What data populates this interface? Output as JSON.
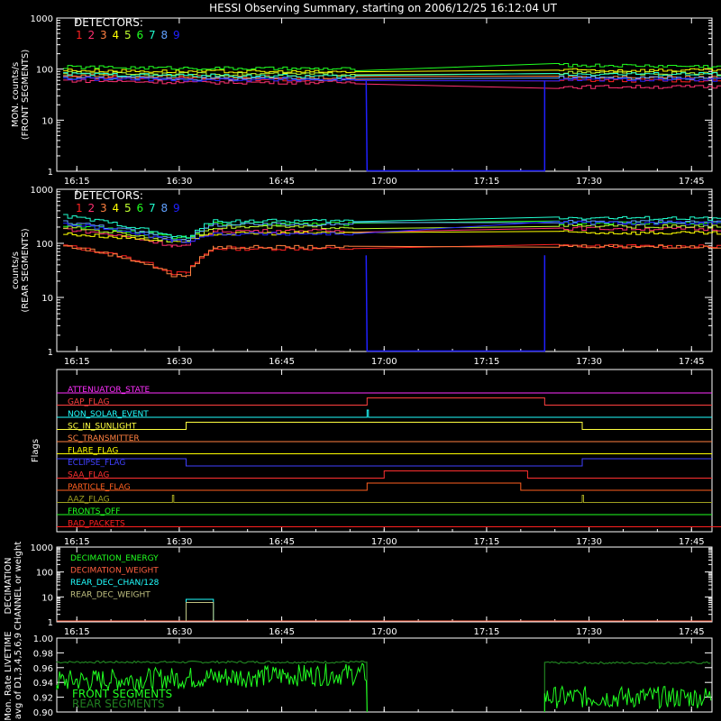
{
  "title": "HESSI Observing Summary, starting on 2006/12/25 16:12:04 UT",
  "time_ticks": [
    "16:15",
    "16:30",
    "16:45",
    "17:00",
    "17:15",
    "17:30",
    "17:45"
  ],
  "detectors": {
    "label": "DETECTORS:",
    "numbers": [
      "1",
      "2",
      "3",
      "4",
      "5",
      "6",
      "7",
      "8",
      "9"
    ],
    "colors": [
      "#ff2020",
      "#ff3070",
      "#ff8040",
      "#ffff00",
      "#c0ff30",
      "#20ff20",
      "#20ffd0",
      "#60a0ff",
      "#2020ff"
    ]
  },
  "panel1": {
    "ylabel1": "MON. counts/s",
    "ylabel2": "(FRONT SEGMENTS)",
    "yticks": [
      "1",
      "10",
      "100",
      "1000"
    ]
  },
  "panel2": {
    "ylabel1": "counts/s",
    "ylabel2": "(REAR SEGMENTS)",
    "yticks": [
      "1",
      "10",
      "100",
      "1000"
    ]
  },
  "panel3": {
    "ylabel": "Flags"
  },
  "panel4": {
    "ylabel1": "DECIMATION",
    "ylabel2": "CHANNEL or weight",
    "yticks": [
      "1",
      "10",
      "100",
      "1000"
    ]
  },
  "panel5": {
    "ylabel1": "Mon. Rate LIVETIME",
    "ylabel2": "avg of D1,3,4,5,6,9",
    "yticks": [
      "0.90",
      "0.92",
      "0.94",
      "0.96",
      "0.98",
      "1.00"
    ],
    "legend": [
      {
        "name": "FRONT SEGMENTS",
        "color": "#20ff20"
      },
      {
        "name": "REAR SEGMENTS",
        "color": "#208020"
      }
    ]
  },
  "chart_data": [
    {
      "type": "line",
      "title": "HESSI Observing Summary, starting on 2006/12/25 16:12:04 UT",
      "ylabel": "MON. counts/s (FRONT SEGMENTS)",
      "yscale": "log",
      "ylim": [
        1,
        1000
      ],
      "x_range": [
        "16:12",
        "18:00"
      ],
      "data_gap": [
        "16:57:30",
        "17:23:30"
      ],
      "series": [
        {
          "name": "1",
          "values": [
            70,
            65,
            62,
            1,
            60,
            60
          ]
        },
        {
          "name": "2",
          "values": [
            60,
            55,
            55,
            1,
            45,
            45
          ]
        },
        {
          "name": "3",
          "values": [
            75,
            70,
            68,
            1,
            70,
            70
          ]
        },
        {
          "name": "4",
          "values": [
            95,
            90,
            88,
            1,
            95,
            95
          ]
        },
        {
          "name": "5",
          "values": [
            85,
            80,
            80,
            1,
            85,
            80
          ]
        },
        {
          "name": "6",
          "values": [
            110,
            105,
            100,
            1,
            120,
            110
          ]
        },
        {
          "name": "7",
          "values": [
            80,
            75,
            72,
            1,
            80,
            80
          ]
        },
        {
          "name": "8",
          "values": [
            68,
            65,
            64,
            1,
            68,
            66
          ]
        },
        {
          "name": "9",
          "values": [
            65,
            62,
            62,
            1,
            62,
            62
          ]
        }
      ],
      "x": [
        "16:13",
        "16:30",
        "16:56",
        "17:10",
        "17:25",
        "18:00"
      ]
    },
    {
      "type": "line",
      "ylabel": "counts/s (REAR SEGMENTS)",
      "yscale": "log",
      "ylim": [
        1,
        1000
      ],
      "x": [
        "16:13",
        "16:29",
        "16:31",
        "16:35",
        "16:56",
        "17:10",
        "17:25",
        "18:00"
      ],
      "series": [
        {
          "name": "1",
          "values": [
            90,
            28,
            28,
            80,
            80,
            1,
            90,
            85
          ]
        },
        {
          "name": "2",
          "values": [
            185,
            90,
            90,
            170,
            170,
            1,
            190,
            180
          ]
        },
        {
          "name": "3",
          "values": [
            90,
            25,
            25,
            85,
            85,
            1,
            90,
            85
          ]
        },
        {
          "name": "4",
          "values": [
            150,
            110,
            110,
            150,
            160,
            1,
            160,
            150
          ]
        },
        {
          "name": "5",
          "values": [
            200,
            110,
            110,
            200,
            200,
            1,
            210,
            200
          ]
        },
        {
          "name": "6",
          "values": [
            220,
            130,
            130,
            230,
            230,
            1,
            240,
            240
          ]
        },
        {
          "name": "7",
          "values": [
            320,
            130,
            130,
            260,
            260,
            1,
            300,
            280
          ]
        },
        {
          "name": "8",
          "values": [
            250,
            120,
            120,
            220,
            230,
            1,
            250,
            250
          ]
        },
        {
          "name": "9",
          "values": [
            230,
            110,
            110,
            150,
            150,
            1,
            240,
            230
          ]
        }
      ]
    },
    {
      "type": "line",
      "ylabel": "Flags",
      "series": [
        {
          "name": "ATTENUATOR_STATE",
          "color": "#ff30ff",
          "state": "off"
        },
        {
          "name": "GAP_FLAG",
          "color": "#ff4040",
          "high": [
            [
              "16:57:30",
              "17:23:30"
            ]
          ]
        },
        {
          "name": "NON_SOLAR_EVENT",
          "color": "#20ffff",
          "spikes": [
            "16:57:30"
          ]
        },
        {
          "name": "SC_IN_SUNLIGHT",
          "color": "#ffff40",
          "high": [
            [
              "16:31",
              "17:29"
            ]
          ]
        },
        {
          "name": "SC_TRANSMITTER",
          "color": "#ff8040",
          "state": "off"
        },
        {
          "name": "FLARE_FLAG",
          "color": "#ffff00",
          "state": "off"
        },
        {
          "name": "ECLIPSE_FLAG",
          "color": "#4040ff",
          "high": [
            [
              "16:12",
              "16:31"
            ],
            [
              "17:29",
              "18:00"
            ]
          ]
        },
        {
          "name": "SAA_FLAG",
          "color": "#ff3030",
          "high": [
            [
              "17:00",
              "17:21"
            ]
          ]
        },
        {
          "name": "PARTICLE_FLAG",
          "color": "#ff6020",
          "high": [
            [
              "16:57:30",
              "17:20"
            ]
          ]
        },
        {
          "name": "AAZ_FLAG",
          "color": "#a0a020",
          "spikes": [
            "16:29",
            "17:29"
          ]
        },
        {
          "name": "FRONTS_OFF",
          "color": "#20ff20",
          "state": "off"
        },
        {
          "name": "BAD_PACKETS",
          "color": "#ff2020",
          "spikes": [
            "17:50"
          ]
        }
      ]
    },
    {
      "type": "line",
      "ylabel": "DECIMATION CHANNEL or weight",
      "yscale": "log",
      "ylim": [
        1,
        1000
      ],
      "series": [
        {
          "name": "DECIMATION_ENERGY",
          "color": "#20ff20",
          "values": [
            1
          ]
        },
        {
          "name": "DECIMATION_WEIGHT",
          "color": "#ff6040",
          "values": [
            1
          ]
        },
        {
          "name": "REAR_DEC_CHAN/128",
          "color": "#20ffff",
          "segment": [
            "16:31",
            "16:35"
          ],
          "value": 8
        },
        {
          "name": "REAR_DEC_WEIGHT",
          "color": "#c0c080",
          "segment": [
            "16:31",
            "16:35"
          ],
          "value": 6
        }
      ]
    },
    {
      "type": "line",
      "ylabel": "Mon. Rate LIVETIME avg of D1,3,4,5,6,9",
      "ylim": [
        0.9,
        1.0
      ],
      "series": [
        {
          "name": "FRONT SEGMENTS",
          "x": [
            "16:13",
            "16:56",
            "17:25",
            "18:00"
          ],
          "values": [
            0.95,
            0.958,
            0.915,
            0.925
          ]
        },
        {
          "name": "REAR SEGMENTS",
          "x": [
            "16:13",
            "16:56",
            "17:25",
            "18:00"
          ],
          "values": [
            0.967,
            0.969,
            0.966,
            0.967
          ]
        }
      ]
    }
  ]
}
